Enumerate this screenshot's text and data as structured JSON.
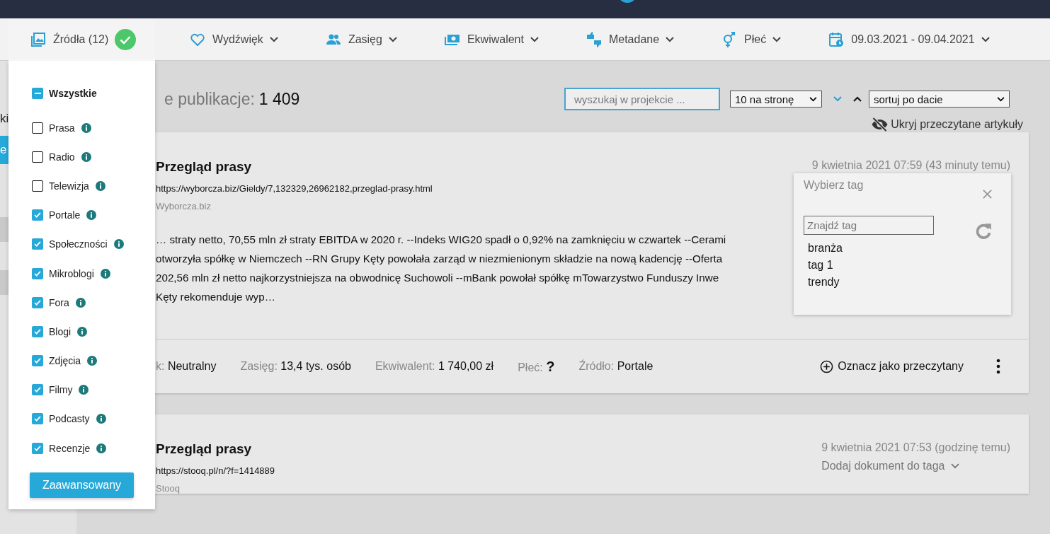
{
  "filters": [
    {
      "kind": "sources",
      "label": "Źródła (12)",
      "selected": true,
      "confirmed": true
    },
    {
      "kind": "sentiment",
      "label": "Wydźwięk",
      "selected": false,
      "confirmed": false
    },
    {
      "kind": "reach",
      "label": "Zasięg",
      "selected": false,
      "confirmed": false
    },
    {
      "kind": "equivalent",
      "label": "Ekwiwalent",
      "selected": false,
      "confirmed": false
    },
    {
      "kind": "metadata",
      "label": "Metadane",
      "selected": false,
      "confirmed": false
    },
    {
      "kind": "gender",
      "label": "Płeć",
      "selected": false,
      "confirmed": false
    },
    {
      "kind": "date",
      "label": "09.03.2021 - 09.04.2021",
      "selected": false,
      "confirmed": false
    }
  ],
  "sidebar": {
    "items": [
      {
        "label": "ki",
        "selected": false
      },
      {
        "label": "e",
        "selected": true
      }
    ]
  },
  "sources_panel": {
    "all": {
      "label": "Wszystkie",
      "indeterminate": true
    },
    "items": [
      {
        "label": "Prasa",
        "checked": false
      },
      {
        "label": "Radio",
        "checked": false
      },
      {
        "label": "Telewizja",
        "checked": false
      },
      {
        "label": "Portale",
        "checked": true
      },
      {
        "label": "Społeczności",
        "checked": true
      },
      {
        "label": "Mikroblogi",
        "checked": true
      },
      {
        "label": "Fora",
        "checked": true
      },
      {
        "label": "Blogi",
        "checked": true
      },
      {
        "label": "Zdjęcia",
        "checked": true
      },
      {
        "label": "Filmy",
        "checked": true
      },
      {
        "label": "Podcasty",
        "checked": true
      },
      {
        "label": "Recenzje",
        "checked": true
      }
    ],
    "button": "Zaawansowany"
  },
  "results": {
    "label": "e publikacje:",
    "count": "1 409",
    "search_placeholder": "wyszukaj w projekcie ...",
    "per_page": "10 na stronę",
    "descending": true,
    "sort": "sortuj po dacie",
    "hide_read": "Ukryj przeczytane artykuły"
  },
  "articles": [
    {
      "title": "Przegląd prasy",
      "url": "https://wyborcza.biz/Gieldy/7,132329,26962182,przeglad-prasy.html",
      "source": "Wyborcza.biz",
      "date": "9 kwietnia 2021 07:59 (43 minuty temu)",
      "excerpt_lines": [
        "… straty netto, 70,55 mln zł straty EBITDA w 2020 r. --Indeks WIG20 spadł o 0,92% na zamknięciu w czwartek --Cerami",
        "otworzyła spółkę w Niemczech --RN Grupy Kęty powołała zarząd w niezmienionym składzie na nową kadencję --Oferta",
        "202,56 mln zł netto najkorzystniejsza na obwodnicę Suchowoli --mBank powołał spółkę mTowarzystwo Funduszy Inwe",
        "Kęty rekomenduje wyp…"
      ],
      "meta": [
        {
          "label": "k:",
          "value": "Neutralny",
          "kind": "text"
        },
        {
          "label": "Zasięg:",
          "value": "13,4 tys. osób",
          "kind": "text"
        },
        {
          "label": "Ekwiwalent:",
          "value": "1 740,00 zł",
          "kind": "text"
        },
        {
          "label": "Płeć:",
          "value": "?",
          "kind": "unknown"
        },
        {
          "label": "Źródło:",
          "value": "Portale",
          "kind": "text"
        }
      ],
      "mark_read": "Oznacz jako przeczytany",
      "tag_popup": {
        "title": "Wybierz tag",
        "placeholder": "Znajdź tag",
        "tags": [
          "branża",
          "tag 1",
          "trendy"
        ]
      }
    },
    {
      "title": "Przegląd prasy",
      "url": "https://stooq.pl/n/?f=1414889",
      "source": "Stooq",
      "date": "9 kwietnia 2021 07:53 (godzinę temu)",
      "tag_action": "Dodaj dokument do taga"
    }
  ]
}
